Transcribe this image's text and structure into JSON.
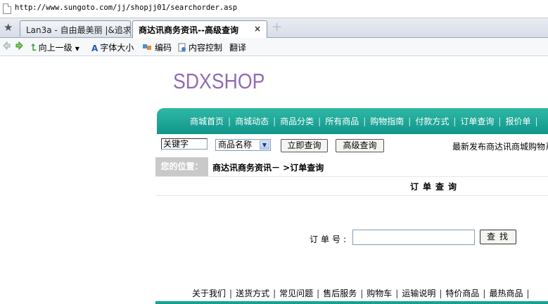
{
  "browser": {
    "url": "http://www.sungoto.com/jj/shopjj01/searchorder.asp",
    "tabs": [
      {
        "label": "Lan3a - 自由最美丽 |&追求",
        "active": false
      },
      {
        "label": "商达讯商务资讯--高级查询",
        "active": true
      }
    ],
    "close_glyph": "×",
    "newtab_glyph": "+",
    "toolbar": {
      "up_label": "向上一级",
      "font_size_label": "字体大小",
      "encoding_label": "编码",
      "content_control_label": "内容控制",
      "translate_label": "翻译"
    }
  },
  "site": {
    "logo": "SDXSHOP",
    "nav": [
      "商城首页",
      "商城动态",
      "商品分类",
      "所有商品",
      "购物指南",
      "付款方式",
      "订单查询",
      "报价单"
    ],
    "nav_sep": "|",
    "search": {
      "keyword_value": "关键字",
      "select_value": "商品名称",
      "search_button": "立即查询",
      "advanced_button": "高级查询",
      "marquee_text": "最新发布商达讯商城购物系统"
    },
    "breadcrumb": {
      "label": "您的位置：",
      "path": "商达讯商务资讯－ >订单查询"
    },
    "order_query": {
      "heading": "订单查询",
      "order_label": "订单号:",
      "order_value": "",
      "find_button": "查找"
    },
    "footer": [
      "关于我们",
      "送货方式",
      "常见问题",
      "售后服务",
      "购物车",
      "运输说明",
      "特价商品",
      "最热商品"
    ],
    "footer_sep": "|"
  },
  "colors": {
    "nav_teal": "#10968a",
    "logo_purple": "#8f6bb6",
    "breadcrumb_gray": "#c9c9c9"
  }
}
